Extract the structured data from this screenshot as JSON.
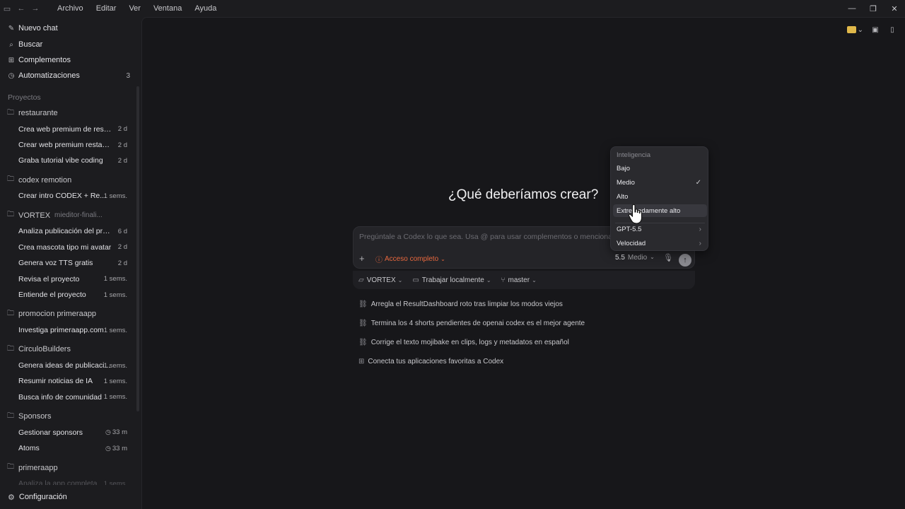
{
  "titlebar": {
    "menus": [
      "Archivo",
      "Editar",
      "Ver",
      "Ventana",
      "Ayuda"
    ]
  },
  "sidebar": {
    "top_items": [
      {
        "label": "Nuevo chat",
        "icon": "new-chat-icon"
      },
      {
        "label": "Buscar",
        "icon": "search-icon"
      },
      {
        "label": "Complementos",
        "icon": "grid-icon"
      },
      {
        "label": "Automatizaciones",
        "icon": "clock-icon",
        "count": "3"
      }
    ],
    "projects_title": "Proyectos",
    "projects": [
      {
        "name": "restaurante",
        "sub": "",
        "threads": [
          {
            "label": "Crea web premium de resta...",
            "age": "2 d"
          },
          {
            "label": "Crear web premium restaura...",
            "age": "2 d"
          },
          {
            "label": "Graba tutorial vibe coding",
            "age": "2 d"
          }
        ]
      },
      {
        "name": "codex remotion",
        "sub": "",
        "threads": [
          {
            "label": "Crear intro CODEX + Re...",
            "age": "1 sems."
          }
        ]
      },
      {
        "name": "VORTEX",
        "sub": "mieditor-finali...",
        "threads": [
          {
            "label": "Analiza publicación del proy...",
            "age": "6 d"
          },
          {
            "label": "Crea mascota tipo mi avatar",
            "age": "2 d"
          },
          {
            "label": "Genera voz TTS gratis",
            "age": "2 d"
          },
          {
            "label": "Revisa el proyecto",
            "age": "1 sems."
          },
          {
            "label": "Entiende el proyecto",
            "age": "1 sems."
          }
        ]
      },
      {
        "name": "promocion primeraapp",
        "sub": "",
        "threads": [
          {
            "label": "Investiga primeraapp.com",
            "age": "1 sems."
          }
        ]
      },
      {
        "name": "CirculoBuilders",
        "sub": "",
        "threads": [
          {
            "label": "Genera ideas de publicaci...",
            "age": "1 sems."
          },
          {
            "label": "Resumir noticias de IA",
            "age": "1 sems."
          },
          {
            "label": "Busca info de comunidad",
            "age": "1 sems."
          }
        ]
      },
      {
        "name": "Sponsors",
        "sub": "",
        "threads": [
          {
            "label": "Gestionar sponsors",
            "age": "33 m",
            "clock": true
          },
          {
            "label": "Atoms",
            "age": "33 m",
            "clock": true
          }
        ]
      },
      {
        "name": "primeraapp",
        "sub": "",
        "threads": [
          {
            "label": "Analiza la app completa",
            "age": "1 sems.",
            "faded": true
          }
        ]
      }
    ],
    "settings_label": "Configuración"
  },
  "main": {
    "headline": "¿Qué deberíamos crear?",
    "composer": {
      "placeholder": "Pregúntale a Codex lo que sea. Usa @ para usar complementos o mencionar arch",
      "access_label": "Acceso completo",
      "model_version": "5.5",
      "model_level": "Medio"
    },
    "context": {
      "project": "VORTEX",
      "mode": "Trabajar localmente",
      "branch": "master"
    },
    "suggestions": [
      {
        "label": "Arregla el ResultDashboard roto tras limpiar los modos viejos",
        "icon": "link-icon"
      },
      {
        "label": "Termina los 4 shorts pendientes de openai codex es el mejor agente",
        "icon": "link-icon"
      },
      {
        "label": "Corrige el texto mojibake en clips, logs y metadatos en español",
        "icon": "link-icon"
      },
      {
        "label": "Conecta tus aplicaciones favoritas a Codex",
        "icon": "grid-icon"
      }
    ]
  },
  "dropdown": {
    "header": "Inteligencia",
    "items": [
      {
        "label": "Bajo"
      },
      {
        "label": "Medio",
        "checked": true
      },
      {
        "label": "Alto"
      },
      {
        "label": "Extremadamente alto",
        "hover": true
      }
    ],
    "submenus": [
      {
        "label": "GPT-5.5"
      },
      {
        "label": "Velocidad"
      }
    ]
  },
  "colors": {
    "accent_access": "#e8683e",
    "folder": "#e0b84a"
  }
}
